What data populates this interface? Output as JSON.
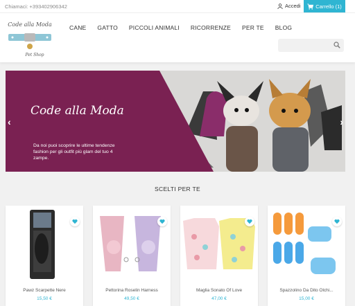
{
  "topbar": {
    "phone": "Chiamaci: +393402906342",
    "login_label": "Accedi",
    "cart_label": "Carrello (1)"
  },
  "header": {
    "logo_text_top": "Code alla Moda",
    "logo_text_bottom": "Pet Shop",
    "nav": [
      "CANE",
      "GATTO",
      "PICCOLI ANIMALI",
      "RICORRENZE",
      "PER TE",
      "BLOG"
    ],
    "search_placeholder": ""
  },
  "slider": {
    "title": "Code alla Moda",
    "description": "Da noi puoi scoprire le ultime tendenze fashion per gli outfit più glam del tuo 4 zampe.",
    "prev_icon": "chevron-left-icon",
    "next_icon": "chevron-right-icon"
  },
  "section": {
    "title": "SCELTI PER TE"
  },
  "products": [
    {
      "name": "Pawz Scarpette Nere",
      "price": "15,50 €"
    },
    {
      "name": "Pettorina Roselin Harness",
      "price": "49,50 €"
    },
    {
      "name": "Maglia Sonato Of Love",
      "price": "47,00 €"
    },
    {
      "name": "Spazzolino Da Dito Olchi...",
      "price": "15,00 €"
    }
  ],
  "colors": {
    "accent": "#2fb5d2",
    "banner": "#7a2152"
  }
}
